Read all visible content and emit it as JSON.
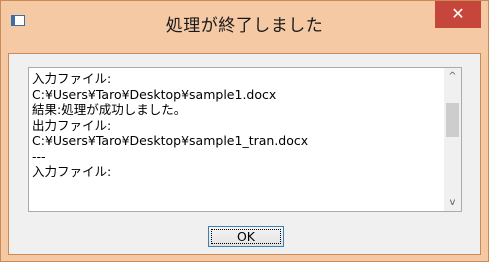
{
  "window": {
    "title": "処理が終了しました",
    "close_label": "✕"
  },
  "message": {
    "lines": [
      "入力ファイル:",
      "C:¥Users¥Taro¥Desktop¥sample1.docx",
      "結果:処理が成功しました。",
      "出力ファイル:",
      "C:¥Users¥Taro¥Desktop¥sample1_tran.docx",
      "---",
      "入力ファイル:"
    ]
  },
  "scrollbar": {
    "up_icon": "chevron-up-icon",
    "down_icon": "chevron-down-icon",
    "up_glyph": "^",
    "down_glyph": "v"
  },
  "buttons": {
    "ok_label": "OK"
  }
}
